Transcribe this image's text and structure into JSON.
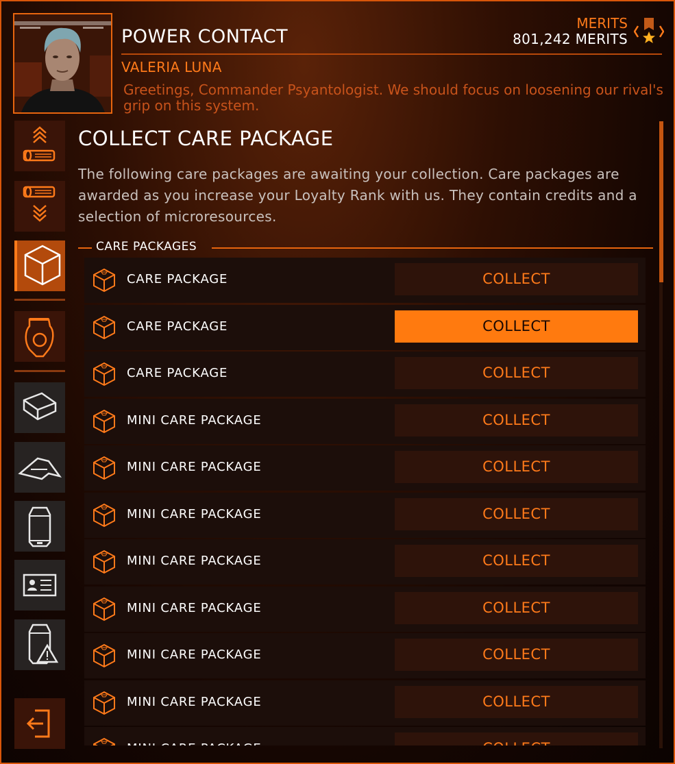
{
  "header": {
    "title": "POWER CONTACT",
    "contact_name": "VALERIA LUNA",
    "greeting": "Greetings, Commander Psyantologist. We should focus on loosening our rival's grip on this system.",
    "merits_label": "MERITS",
    "merits_value": "801,242 MERITS"
  },
  "sidebar": {
    "items": [
      {
        "name": "rank-up-icon",
        "active": false
      },
      {
        "name": "rank-down-icon",
        "active": false
      },
      {
        "name": "care-package-icon",
        "active": true
      },
      {
        "name": "power-contact-icon",
        "active": false
      },
      {
        "name": "cargo-icon",
        "active": false
      },
      {
        "name": "ship-icon",
        "active": false
      },
      {
        "name": "canister-icon",
        "active": false
      },
      {
        "name": "id-card-icon",
        "active": false
      },
      {
        "name": "hazard-canister-icon",
        "active": false
      },
      {
        "name": "exit-icon",
        "active": false
      }
    ]
  },
  "main": {
    "section_title": "COLLECT CARE PACKAGE",
    "description": "The following care packages are awaiting your collection.  Care packages are awarded as you increase your Loyalty Rank with us. They contain credits and a selection of microresources.",
    "group_label": "CARE PACKAGES",
    "packages": [
      {
        "label": "CARE PACKAGE",
        "button": "COLLECT",
        "selected": false
      },
      {
        "label": "CARE PACKAGE",
        "button": "COLLECT",
        "selected": true
      },
      {
        "label": "CARE PACKAGE",
        "button": "COLLECT",
        "selected": false
      },
      {
        "label": "MINI CARE PACKAGE",
        "button": "COLLECT",
        "selected": false
      },
      {
        "label": "MINI CARE PACKAGE",
        "button": "COLLECT",
        "selected": false
      },
      {
        "label": "MINI CARE PACKAGE",
        "button": "COLLECT",
        "selected": false
      },
      {
        "label": "MINI CARE PACKAGE",
        "button": "COLLECT",
        "selected": false
      },
      {
        "label": "MINI CARE PACKAGE",
        "button": "COLLECT",
        "selected": false
      },
      {
        "label": "MINI CARE PACKAGE",
        "button": "COLLECT",
        "selected": false
      },
      {
        "label": "MINI CARE PACKAGE",
        "button": "COLLECT",
        "selected": false
      },
      {
        "label": "MINI CARE PACKAGE",
        "button": "COLLECT",
        "selected": false
      }
    ]
  },
  "colors": {
    "accent": "#ff7a1a",
    "border": "#d9560a",
    "active_button": "#ff7a0f",
    "row_bg": "#1c0e0a",
    "button_bg": "#2e130a"
  }
}
